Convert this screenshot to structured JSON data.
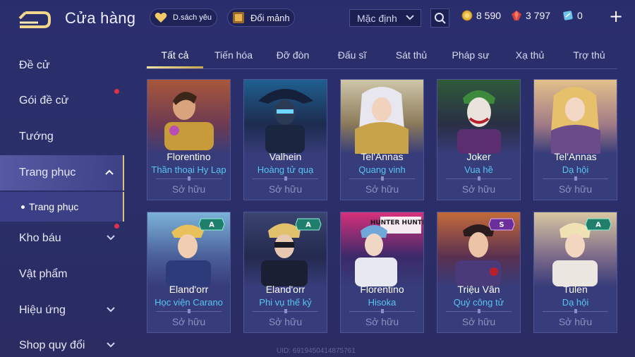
{
  "header": {
    "title": "Cửa hàng",
    "favorites_label": "D.sách yêu",
    "fragments_label": "Đổi mảnh",
    "sort_value": "Mặc định",
    "currencies": [
      {
        "icon": "gold-coin-icon",
        "value": "8 590"
      },
      {
        "icon": "ruby-icon",
        "value": "3 797"
      },
      {
        "icon": "voucher-icon",
        "value": "0"
      }
    ]
  },
  "sidebar": {
    "items": [
      {
        "label": "Đề cử"
      },
      {
        "label": "Gói đề cử"
      },
      {
        "label": "Tướng"
      },
      {
        "label": "Trang phục"
      },
      {
        "label": "Kho báu"
      },
      {
        "label": "Vật phẩm"
      },
      {
        "label": "Hiệu ứng"
      },
      {
        "label": "Shop quy đổi"
      }
    ],
    "sub_item": "Trang phục"
  },
  "tabs": [
    "Tất cả",
    "Tiến hóa",
    "Đỡ đòn",
    "Đấu sĩ",
    "Sát thủ",
    "Pháp sư",
    "Xạ thủ",
    "Trợ thủ"
  ],
  "cards": [
    {
      "hero": "Florentino",
      "skin": "Thần thoại Hy Lạp",
      "status": "Sở hữu"
    },
    {
      "hero": "Valhein",
      "skin": "Hoàng tử quạ",
      "status": "Sở hữu"
    },
    {
      "hero": "Tel'Annas",
      "skin": "Quang vinh",
      "status": "Sở hữu"
    },
    {
      "hero": "Joker",
      "skin": "Vua hề",
      "status": "Sở hữu"
    },
    {
      "hero": "Tel'Annas",
      "skin": "Dạ hội",
      "status": "Sở hữu"
    },
    {
      "hero": "Eland'orr",
      "skin": "Học viện Carano",
      "status": "Sở hữu",
      "tier": "A"
    },
    {
      "hero": "Eland'orr",
      "skin": "Phi vụ thế kỷ",
      "status": "Sở hữu",
      "tier": "A"
    },
    {
      "hero": "Florentino",
      "skin": "Hisoka",
      "status": "Sở hữu",
      "banner": "HUNTER HUNTER"
    },
    {
      "hero": "Triệu Vân",
      "skin": "Quý công tử",
      "status": "Sở hữu",
      "tier": "S"
    },
    {
      "hero": "Tulen",
      "skin": "Dạ hội",
      "status": "Sở hữu",
      "tier": "A"
    }
  ],
  "footer": {
    "uid": "UID: 6919450414875761"
  },
  "colors": {
    "accent_gold": "#d9c27a",
    "skin_text": "#58c5f2",
    "notification": "#e0314a"
  }
}
